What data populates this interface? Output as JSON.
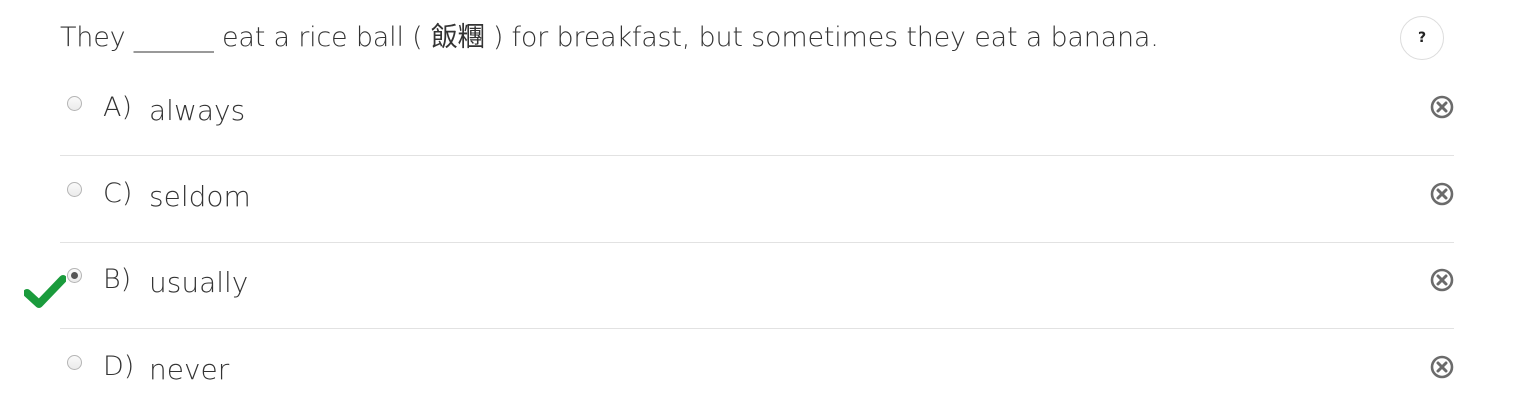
{
  "question": {
    "text": "They ______ eat a rice ball ( 飯糰 ) for breakfast, but sometimes they eat a banana."
  },
  "help_button": {
    "label": "?"
  },
  "options": [
    {
      "letter": "A)",
      "text": "always",
      "selected": false,
      "icon": "remove-icon"
    },
    {
      "letter": "C)",
      "text": "seldom",
      "selected": false,
      "icon": "remove-icon"
    },
    {
      "letter": "B)",
      "text": "usually",
      "selected": true,
      "correct": true,
      "icon": "remove-icon"
    },
    {
      "letter": "D)",
      "text": "never",
      "selected": false,
      "icon": "remove-icon"
    }
  ],
  "colors": {
    "correct_check": "#1a9b3c",
    "remove_icon": "#6b6b6b",
    "divider": "#e2e2e2",
    "text": "#333333"
  },
  "icons": {
    "correct_mark": "checkmark-icon",
    "help": "question-mark",
    "remove": "remove-icon"
  }
}
